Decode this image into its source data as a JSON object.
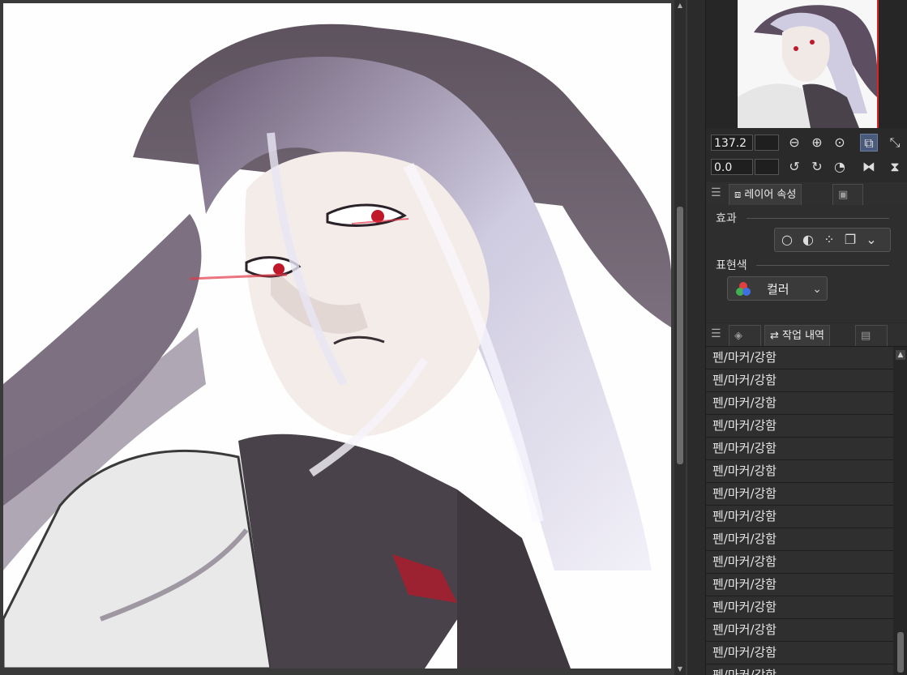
{
  "canvas": {
    "artwork": "illustration-portrait"
  },
  "navigator": {
    "zoom_value": "137.2",
    "rotation_value": "0.0"
  },
  "layer_property_panel": {
    "tab_label": "레이어 속성",
    "effect_label": "효과",
    "expression_color_label": "표현색",
    "expression_color_value": "컬러"
  },
  "history_panel": {
    "tab_label": "작업 내역",
    "items": [
      "펜/마커/강함",
      "펜/마커/강함",
      "펜/마커/강함",
      "펜/마커/강함",
      "펜/마커/강함",
      "펜/마커/강함",
      "펜/마커/강함",
      "펜/마커/강함",
      "펜/마커/강함",
      "펜/마커/강함",
      "펜/마커/강함",
      "펜/마커/강함",
      "펜/마커/강함",
      "펜/마커/강함",
      "펜/마커/강함"
    ]
  },
  "colors": {
    "accent": "#4a5a7a",
    "panel_bg": "#2b2b2b",
    "highlight_red": "#d22222"
  }
}
